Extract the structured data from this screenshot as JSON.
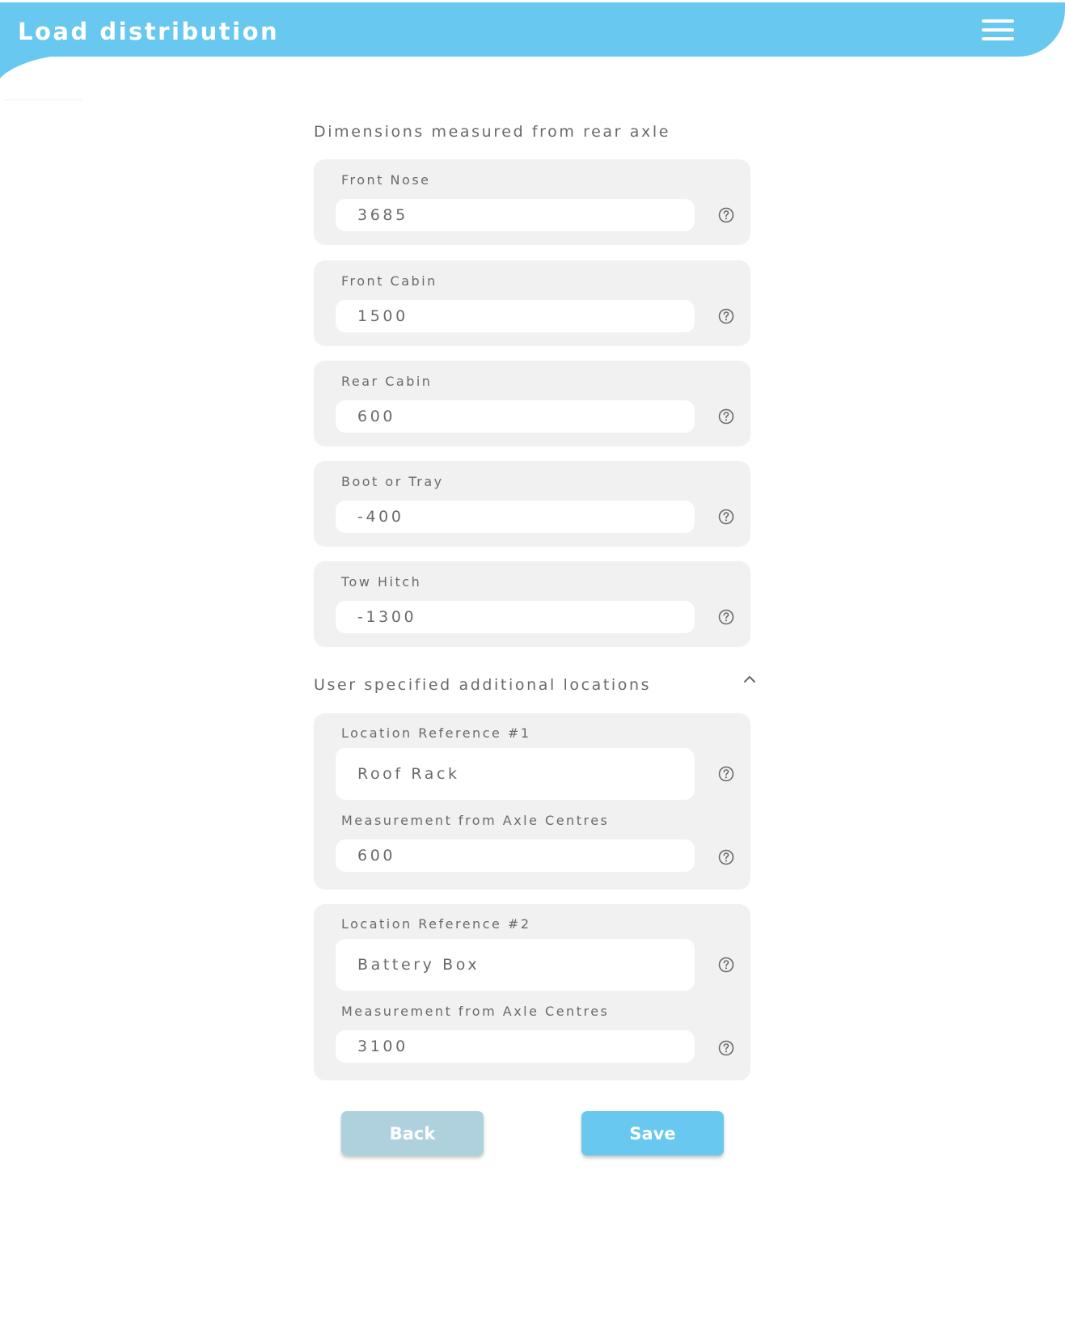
{
  "header": {
    "title": "Load distribution",
    "menu_icon": "hamburger-menu-icon"
  },
  "colors": {
    "accent": "#69c8ef",
    "back_button": "#afd1de",
    "card_background": "#f1f1f1",
    "text": "#6a6a6a"
  },
  "dimensions": {
    "heading": "Dimensions measured from rear axle",
    "fields": [
      {
        "label": "Front Nose",
        "value": "3685"
      },
      {
        "label": "Front Cabin",
        "value": "1500"
      },
      {
        "label": "Rear Cabin",
        "value": "600"
      },
      {
        "label": "Boot or Tray",
        "value": "-400"
      },
      {
        "label": "Tow Hitch",
        "value": "-1300"
      }
    ]
  },
  "additional": {
    "heading": "User specified additional locations",
    "collapse_icon": "chevron-up-icon",
    "locations": [
      {
        "ref_label": "Location Reference #1",
        "ref_value": "Roof Rack",
        "measure_label": "Measurement from Axle Centres",
        "measure_value": "600"
      },
      {
        "ref_label": "Location Reference #2",
        "ref_value": "Battery Box",
        "measure_label": "Measurement from Axle Centres",
        "measure_value": "3100"
      }
    ]
  },
  "help_icon": "question-circle-icon",
  "buttons": {
    "back": "Back",
    "save": "Save"
  }
}
